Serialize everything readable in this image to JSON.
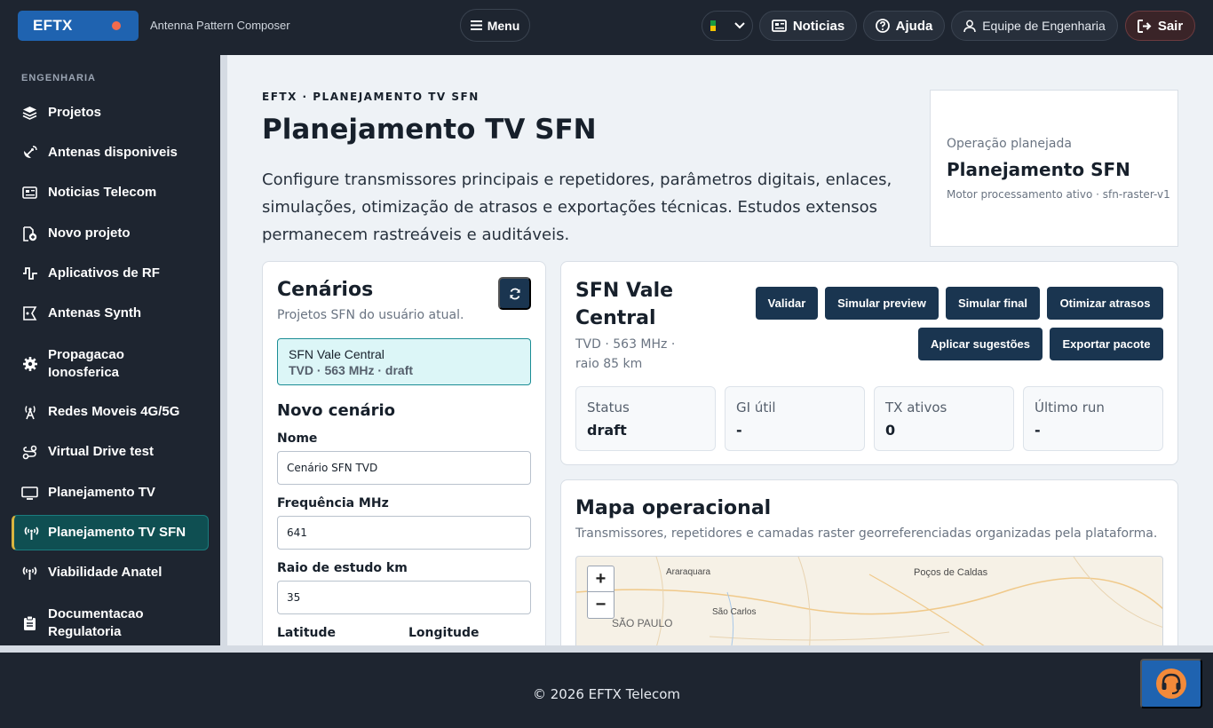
{
  "header": {
    "brand": "EFTX",
    "subtitle": "Antenna Pattern Composer",
    "menu_label": "Menu",
    "news_label": "Noticias",
    "help_label": "Ajuda",
    "team_label": "Equipe de Engenharia",
    "logout_label": "Sair",
    "accent_color": "#1f63b0",
    "brand_dot_color": "#f26b4d"
  },
  "sidebar": {
    "section": "ENGENHARIA",
    "items": [
      {
        "label": "Projetos",
        "icon": "layers-icon"
      },
      {
        "label": "Antenas disponiveis",
        "icon": "satellite-dish-icon"
      },
      {
        "label": "Noticias Telecom",
        "icon": "newspaper-icon"
      },
      {
        "label": "Novo projeto",
        "icon": "file-plus-icon"
      },
      {
        "label": "Aplicativos de RF",
        "icon": "signal-wave-icon"
      },
      {
        "label": "Antenas Synth",
        "icon": "antenna-synth-icon"
      },
      {
        "label": "Propagacao Ionosferica",
        "icon": "gear-icon"
      },
      {
        "label": "Redes Moveis 4G/5G",
        "icon": "cell-tower-icon"
      },
      {
        "label": "Virtual Drive test",
        "icon": "route-icon"
      },
      {
        "label": "Planejamento TV",
        "icon": "tv-icon"
      },
      {
        "label": "Planejamento TV SFN",
        "icon": "broadcast-icon",
        "active": true
      },
      {
        "label": "Viabilidade Anatel",
        "icon": "broadcast-icon"
      },
      {
        "label": "Documentacao Regulatoria",
        "icon": "clipboard-icon"
      }
    ]
  },
  "page": {
    "eyebrow": "EFTX · PLANEJAMENTO TV SFN",
    "title": "Planejamento TV SFN",
    "description": "Configure transmissores principais e repetidores, parâmetros digitais, enlaces, simulações, otimização de atrasos e exportações técnicas. Estudos extensos permanecem rastreáveis e auditáveis."
  },
  "operation": {
    "label": "Operação planejada",
    "title": "Planejamento SFN",
    "meta": "Motor processamento ativo · sfn-raster-v1"
  },
  "scenarios": {
    "title": "Cenários",
    "subtitle": "Projetos SFN do usuário atual.",
    "selected_name": "SFN Vale Central",
    "selected_meta": "TVD · 563 MHz · draft",
    "new_title": "Novo cenário",
    "fields": {
      "name_label": "Nome",
      "name_value": "Cenário SFN TVD",
      "freq_label": "Frequência MHz",
      "freq_value": "641",
      "radius_label": "Raio de estudo km",
      "radius_value": "35",
      "lat_label": "Latitude",
      "lon_label": "Longitude"
    }
  },
  "detail": {
    "title": "SFN Vale Central",
    "subtitle": "TVD · 563 MHz · raio 85 km",
    "actions": {
      "validate": "Validar",
      "preview": "Simular preview",
      "final": "Simular final",
      "optimize": "Otimizar atrasos",
      "apply": "Aplicar sugestões",
      "export": "Exportar pacote"
    },
    "stats": [
      {
        "label": "Status",
        "value": "draft"
      },
      {
        "label": "GI útil",
        "value": "-"
      },
      {
        "label": "TX ativos",
        "value": "0"
      },
      {
        "label": "Último run",
        "value": "-"
      }
    ]
  },
  "map": {
    "title": "Mapa operacional",
    "subtitle": "Transmissores, repetidores e camadas raster georreferenciadas organizadas pela plataforma.",
    "zoom_in": "+",
    "zoom_out": "−",
    "cities": [
      "Araraquara",
      "Poços de Caldas",
      "São Carlos",
      "SÃO PAULO"
    ]
  },
  "footer": {
    "text": "© 2026 EFTX Telecom"
  }
}
